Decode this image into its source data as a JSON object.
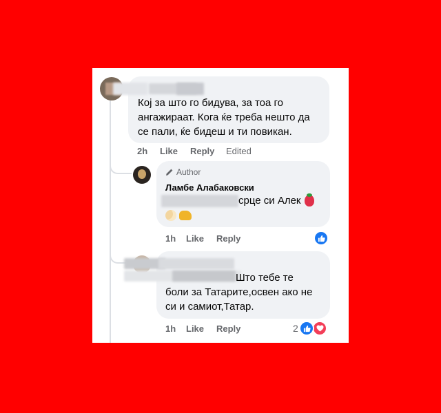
{
  "comments": [
    {
      "text_lines": [
        "Кој за што го бидува, за тоа го",
        "ангажираат. Кога ќе треба нешто да",
        "се пали, ќе бидеш и ти повикан."
      ],
      "time": "2h",
      "like_label": "Like",
      "reply_label": "Reply",
      "edited_label": "Edited"
    },
    {
      "author_badge": "Author",
      "name": "Ламбе Алабаковски",
      "text_visible": "срце си Алек",
      "time": "1h",
      "like_label": "Like",
      "reply_label": "Reply"
    },
    {
      "text_lines": [
        "Што тебе те",
        "боли за Татарите,освен ако не",
        "си и самиот,Татар."
      ],
      "time": "1h",
      "like_label": "Like",
      "reply_label": "Reply",
      "reaction_count": "2"
    }
  ],
  "colors": {
    "background": "#ff0000",
    "bubble": "#f0f2f5",
    "like_blue": "#1877f2",
    "love_red": "#f33e58"
  }
}
